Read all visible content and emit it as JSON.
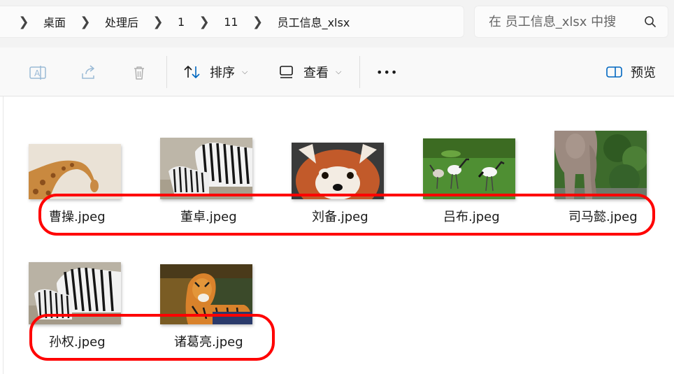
{
  "breadcrumb": {
    "items": [
      "桌面",
      "处理后",
      "1",
      "11",
      "员工信息_xlsx"
    ]
  },
  "search": {
    "placeholder": "在 员工信息_xlsx 中搜"
  },
  "toolbar": {
    "sort_label": "排序",
    "view_label": "查看",
    "more_label": "•••",
    "preview_label": "预览"
  },
  "files": [
    {
      "name": "曹操.jpeg",
      "subject": "giraffe"
    },
    {
      "name": "董卓.jpeg",
      "subject": "zebras"
    },
    {
      "name": "刘备.jpeg",
      "subject": "red panda"
    },
    {
      "name": "吕布.jpeg",
      "subject": "cranes"
    },
    {
      "name": "司马懿.jpeg",
      "subject": "elephant"
    },
    {
      "name": "孙权.jpeg",
      "subject": "zebras"
    },
    {
      "name": "诸葛亮.jpeg",
      "subject": "tiger"
    }
  ],
  "colors": {
    "highlight": "#ff0000",
    "accent": "#0067c0"
  }
}
